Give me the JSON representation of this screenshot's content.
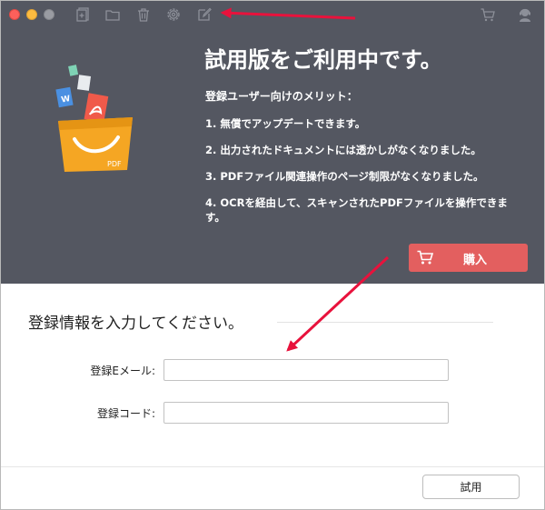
{
  "toolbar": {
    "icons": [
      "add-file-icon",
      "folder-icon",
      "trash-icon",
      "gear-icon",
      "edit-icon"
    ],
    "right_icons": [
      "cart-icon",
      "support-agent-icon"
    ]
  },
  "promo": {
    "headline": "試用版をご利用中です。",
    "benefits_title": "登録ユーザー向けのメリット：",
    "benefits": [
      "1.  無償でアップデートできます。",
      "2. 出力されたドキュメントには透かしがなくなりました。",
      "3. PDFファイル関連操作のページ制限がなくなりました。",
      "4. OCRを経由して、スキャンされたPDFファイルを操作できます。"
    ],
    "buy_label": "購入",
    "illustration_text": "PDF"
  },
  "form": {
    "title": "登録情報を入力してください。",
    "email_label": "登録Eメール:",
    "email_value": "",
    "code_label": "登録コード:",
    "code_value": ""
  },
  "footer": {
    "trial_label": "試用"
  },
  "colors": {
    "panel_bg": "#545761",
    "buy_button": "#e35f5f",
    "annotation_arrow": "#e8123c",
    "basket_orange": "#f5a623"
  }
}
